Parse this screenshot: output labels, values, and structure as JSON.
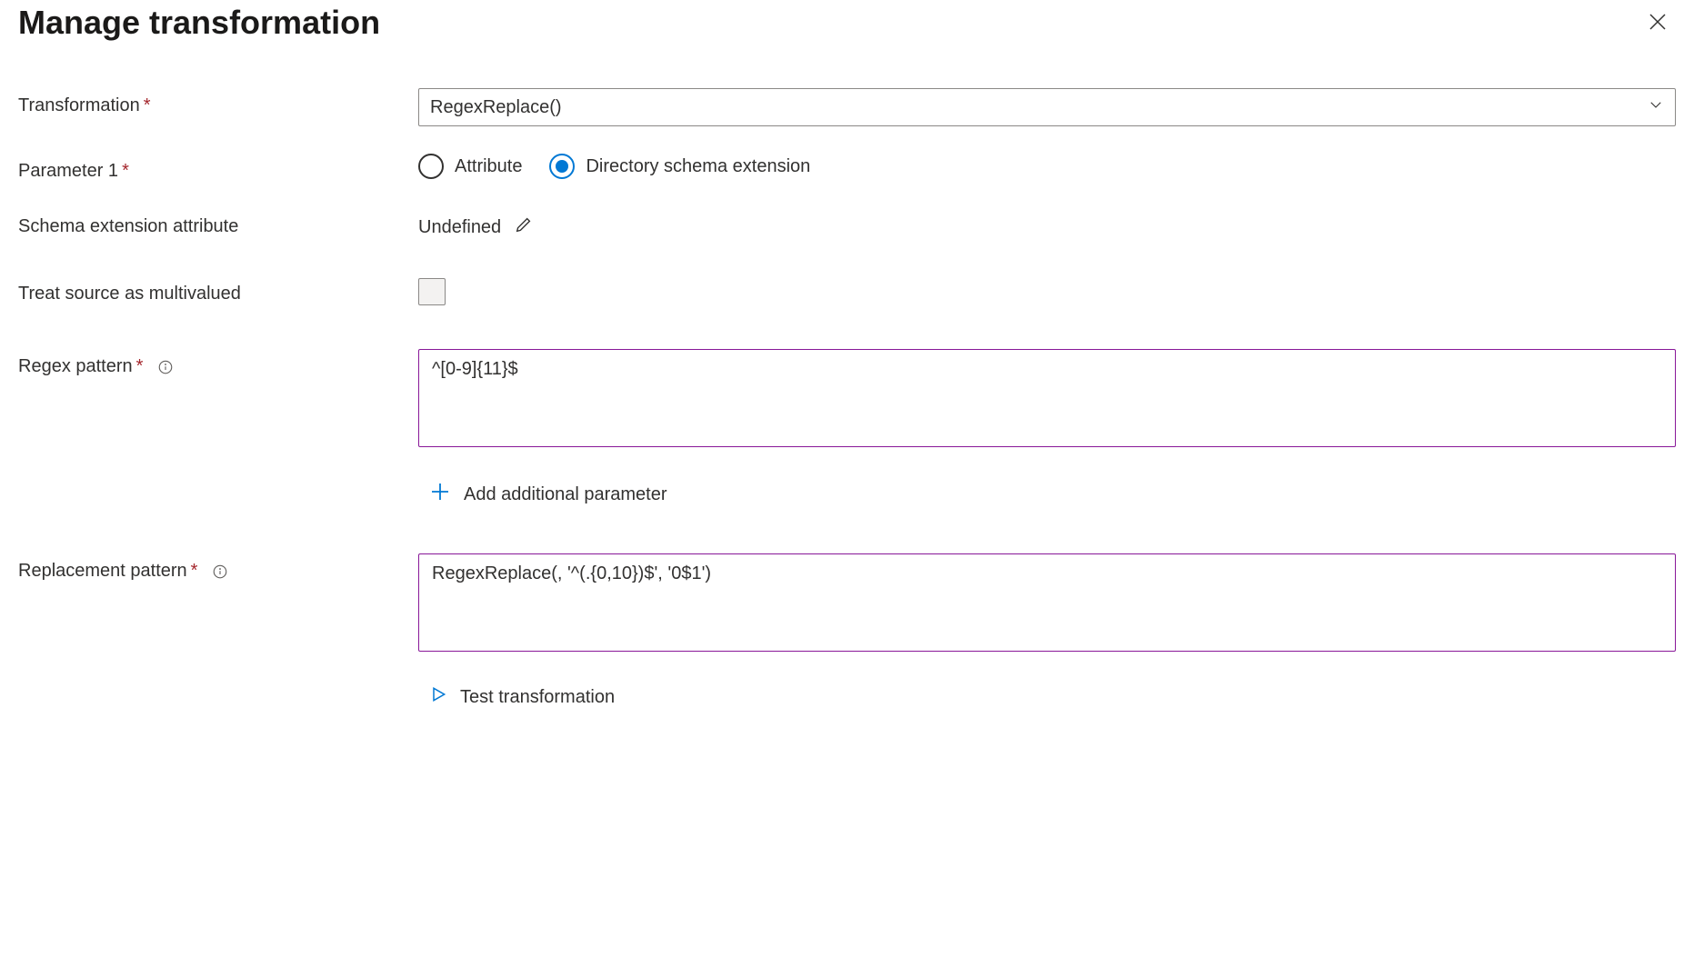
{
  "header": {
    "title": "Manage transformation"
  },
  "form": {
    "transformation": {
      "label": "Transformation",
      "value": "RegexReplace()"
    },
    "parameter1": {
      "label": "Parameter 1",
      "options": {
        "attribute": "Attribute",
        "directory": "Directory schema extension"
      }
    },
    "schemaExtension": {
      "label": "Schema extension attribute",
      "value": "Undefined"
    },
    "multivalued": {
      "label": "Treat source as multivalued"
    },
    "regexPattern": {
      "label": "Regex pattern",
      "value": "^[0-9]{11}$"
    },
    "addParameter": {
      "label": "Add additional parameter"
    },
    "replacementPattern": {
      "label": "Replacement pattern",
      "value": "RegexReplace(, '^(.{0,10})$', '0$1')"
    },
    "testTransformation": {
      "label": "Test transformation"
    }
  }
}
